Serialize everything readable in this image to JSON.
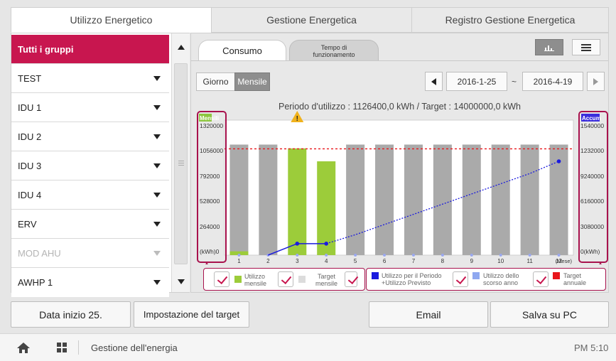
{
  "tabs": [
    "Utilizzo Energetico",
    "Gestione Energetica",
    "Registro Gestione Energetica"
  ],
  "active_tab": 0,
  "sidebar": {
    "items": [
      {
        "label": "Tutti i gruppi",
        "state": "selected"
      },
      {
        "label": "TEST",
        "state": "normal"
      },
      {
        "label": "IDU 1",
        "state": "normal"
      },
      {
        "label": "IDU 2",
        "state": "normal"
      },
      {
        "label": "IDU 3",
        "state": "normal"
      },
      {
        "label": "IDU 4",
        "state": "normal"
      },
      {
        "label": "ERV",
        "state": "normal"
      },
      {
        "label": "MOD AHU",
        "state": "disabled"
      },
      {
        "label": "AWHP 1",
        "state": "normal"
      }
    ]
  },
  "subtabs": {
    "consumo": "Consumo",
    "tempo": "Tempo di funzionamento"
  },
  "period": {
    "giorno": "Giorno",
    "mensile": "Mensile"
  },
  "date_range": {
    "start": "2016-1-25",
    "sep": "~",
    "end": "2016-4-19"
  },
  "summary": "Periodo d'utilizzo : 1126400,0 kWh / Target : 14000000,0 kWh",
  "chart_data": {
    "type": "bar",
    "categories": [
      "1",
      "2",
      "3",
      "4",
      "5",
      "6",
      "7",
      "8",
      "9",
      "10",
      "11",
      "12"
    ],
    "x_unit": "(Mese)",
    "left_axis": {
      "title": "Mensili",
      "unit": "(kWh)",
      "ticks": [
        "1320000",
        "1056000",
        "792000",
        "528000",
        "264000",
        "0"
      ],
      "ylim": [
        0,
        1320000
      ]
    },
    "right_axis": {
      "title": "Accum",
      "unit": "(kWh)",
      "ticks": [
        "1540000",
        "1232000",
        "9240000",
        "6160000",
        "3080000",
        "0"
      ]
    },
    "series": [
      {
        "name": "Utilizzo mensile",
        "color": "#9ccc3a",
        "values": [
          40000,
          0,
          1126400,
          990000,
          0,
          0,
          0,
          0,
          0,
          0,
          0,
          0
        ]
      },
      {
        "name": "Target mensile",
        "color": "#aaaaaa",
        "values": [
          1166667,
          1166667,
          1166667,
          1166667,
          1166667,
          1166667,
          1166667,
          1166667,
          1166667,
          1166667,
          1166667,
          1166667
        ]
      },
      {
        "name": "Utilizzo per il Periodo +Utilizzo Previsto",
        "color": "#1a1adf",
        "values": [
          0,
          0,
          1126400,
          1126400,
          2000000,
          3000000,
          4000000,
          5000000,
          6000000,
          7000000,
          8000000,
          9200000
        ]
      },
      {
        "name": "Utilizzo dello scorso anno",
        "color": "#8fa8f0",
        "values": []
      },
      {
        "name": "Target annuale",
        "color": "#e8161b",
        "values": [
          1166667
        ]
      }
    ],
    "warning_month": "3"
  },
  "legend_left": [
    {
      "label": "Utilizzo mensile",
      "color": "#9ccc3a"
    },
    {
      "label": "Target mensile",
      "color": "#dcdcdc"
    }
  ],
  "legend_right": [
    {
      "label": "Utilizzo per il Periodo +Utilizzo Previsto",
      "color": "#1a1adf"
    },
    {
      "label": "Utilizzo dello scorso anno",
      "color": "#8fa8f0"
    },
    {
      "label": "Target annuale",
      "color": "#e8161b"
    }
  ],
  "buttons": {
    "start_date": "Data inizio 25.",
    "target": "Impostazione del target",
    "email": "Email",
    "save": "Salva su PC"
  },
  "status": {
    "title": "Gestione dell'energia",
    "time": "PM 5:10"
  }
}
